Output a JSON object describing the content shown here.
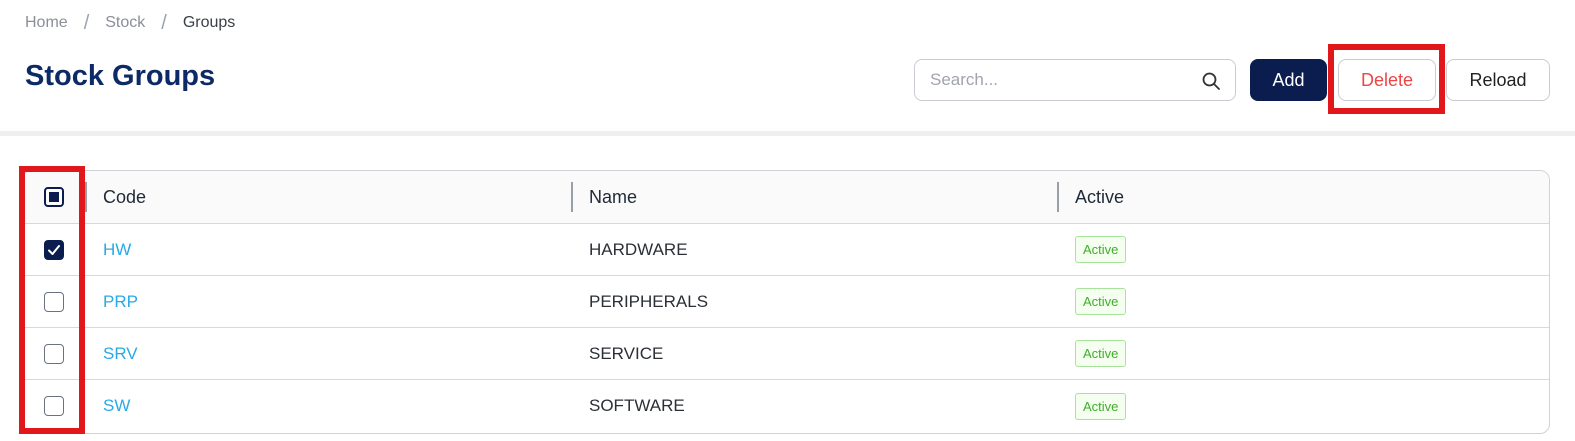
{
  "breadcrumb": {
    "items": [
      "Home",
      "Stock",
      "Groups"
    ],
    "separator": "/"
  },
  "page": {
    "title": "Stock Groups"
  },
  "search": {
    "placeholder": "Search...",
    "value": ""
  },
  "toolbar": {
    "add_label": "Add",
    "delete_label": "Delete",
    "reload_label": "Reload"
  },
  "table": {
    "columns": [
      "Code",
      "Name",
      "Active"
    ],
    "select_all_state": "indeterminate",
    "rows": [
      {
        "code": "HW",
        "name": "HARDWARE",
        "status": "Active",
        "selected": true
      },
      {
        "code": "PRP",
        "name": "PERIPHERALS",
        "status": "Active",
        "selected": false
      },
      {
        "code": "SRV",
        "name": "SERVICE",
        "status": "Active",
        "selected": false
      },
      {
        "code": "SW",
        "name": "SOFTWARE",
        "status": "Active",
        "selected": false
      }
    ]
  },
  "colors": {
    "title": "#0d2a66",
    "primary_button": "#0b1d4f",
    "delete_text": "#ef4444",
    "link": "#29a9e6",
    "badge_green": "#3fae2a",
    "highlight": "#e0181b"
  },
  "icons": {
    "search": "search-icon",
    "check": "check-icon"
  }
}
